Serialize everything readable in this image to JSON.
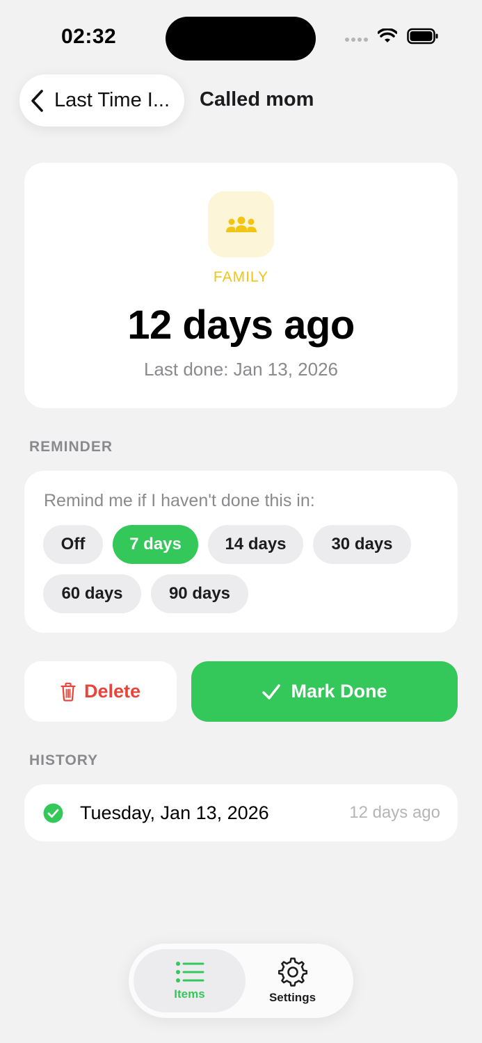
{
  "status_bar": {
    "time": "02:32"
  },
  "nav": {
    "back_label": "Last Time I...",
    "title": "Called mom"
  },
  "summary": {
    "category_icon": "people-group-icon",
    "category": "FAMILY",
    "elapsed": "12 days ago",
    "last_done": "Last done: Jan 13, 2026"
  },
  "reminder": {
    "section_title": "REMINDER",
    "prompt": "Remind me if I haven't done this in:",
    "options": [
      "Off",
      "7 days",
      "14 days",
      "30 days",
      "60 days",
      "90 days"
    ],
    "selected": "7 days"
  },
  "actions": {
    "delete_label": "Delete",
    "done_label": "Mark Done"
  },
  "history": {
    "section_title": "HISTORY",
    "entries": [
      {
        "date": "Tuesday, Jan 13, 2026",
        "ago": "12 days ago"
      }
    ]
  },
  "tabs": [
    {
      "label": "Items",
      "icon": "list-icon"
    },
    {
      "label": "Settings",
      "icon": "gear-icon"
    }
  ],
  "colors": {
    "accent": "#34c759",
    "danger": "#e8443a",
    "category": "#f2c515"
  }
}
